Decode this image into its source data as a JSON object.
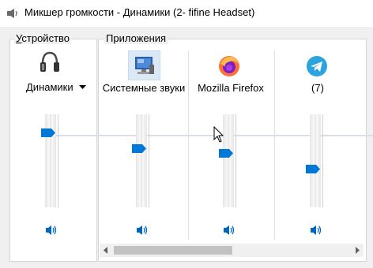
{
  "window": {
    "title": "Микшер громкости - Динамики (2- fifine Headset)"
  },
  "device": {
    "group_label_prefix": "У",
    "group_label_rest": "стройство",
    "name": "Динамики",
    "icon": "headphones-icon",
    "volume_percent": 80
  },
  "apps": {
    "group_label": "Приложения",
    "items": [
      {
        "name": "Системные звуки",
        "icon": "system-sounds-icon",
        "volume_percent": 63
      },
      {
        "name": "Mozilla Firefox",
        "icon": "firefox-icon",
        "volume_percent": 58
      },
      {
        "name": "(7)",
        "icon": "telegram-icon",
        "volume_percent": 41
      }
    ]
  },
  "colors": {
    "accent": "#0078d7",
    "window_bg": "#f0f0f0",
    "panel_bg": "#ffffff"
  }
}
